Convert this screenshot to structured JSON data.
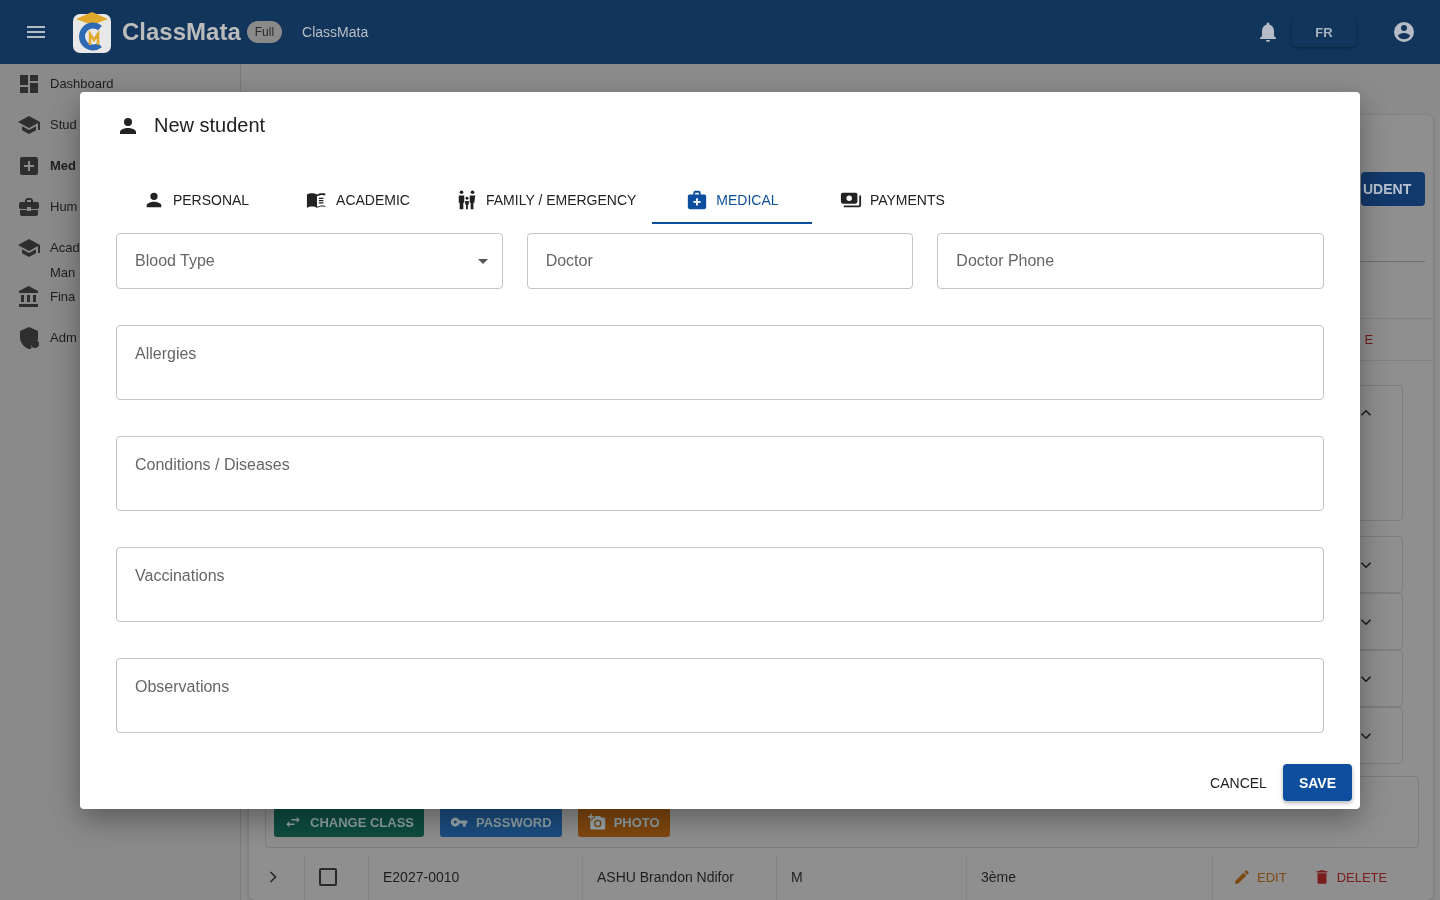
{
  "app_bar": {
    "logo_text": "ClassMata",
    "badge": "Full",
    "subtitle": "ClassMata",
    "language": "FR"
  },
  "sidebar": {
    "items": [
      {
        "label": "Dashboard",
        "selected": false
      },
      {
        "label": "Stud",
        "selected": false
      },
      {
        "label": "Med",
        "selected": true
      },
      {
        "label": "Hum",
        "selected": false
      },
      {
        "label": "Acad\nMan",
        "selected": false
      },
      {
        "label": "Fina",
        "selected": false
      },
      {
        "label": "Adm",
        "selected": false
      }
    ]
  },
  "page": {
    "add_button": "UDENT",
    "row_fragment": "E",
    "panels": [
      {
        "expanded": true
      },
      {
        "expanded": false
      },
      {
        "expanded": false
      },
      {
        "expanded": false
      },
      {
        "expanded": false
      }
    ],
    "actions": [
      {
        "label": "CHANGE CLASS",
        "color": "#0e4d40"
      },
      {
        "label": "PASSWORD",
        "color": "#1b4d80"
      },
      {
        "label": "PHOTO",
        "color": "#80480f"
      }
    ],
    "table_row": {
      "expanded": false,
      "checked": false,
      "cells": [
        "E2027-0010",
        "ASHU Brandon Ndifor",
        "M",
        "3ème"
      ],
      "edit": "EDIT",
      "delete": "DELETE"
    }
  },
  "dialog": {
    "title": "New student",
    "tabs": [
      {
        "label": "PERSONAL",
        "selected": false
      },
      {
        "label": "ACADEMIC",
        "selected": false
      },
      {
        "label": "FAMILY / EMERGENCY",
        "selected": false
      },
      {
        "label": "MEDICAL",
        "selected": true
      },
      {
        "label": "PAYMENTS",
        "selected": false
      }
    ],
    "fields": [
      {
        "kind": "select",
        "placeholder": "Blood Type"
      },
      {
        "kind": "text",
        "placeholder": "Doctor"
      },
      {
        "kind": "text",
        "placeholder": "Doctor Phone"
      },
      {
        "kind": "textarea",
        "placeholder": "Allergies"
      },
      {
        "kind": "textarea",
        "placeholder": "Conditions / Diseases"
      },
      {
        "kind": "textarea",
        "placeholder": "Vaccinations"
      },
      {
        "kind": "textarea",
        "placeholder": "Observations"
      }
    ],
    "buttons": [
      {
        "kind": "cancel",
        "label": "CANCEL"
      },
      {
        "kind": "save",
        "label": "SAVE"
      }
    ]
  }
}
